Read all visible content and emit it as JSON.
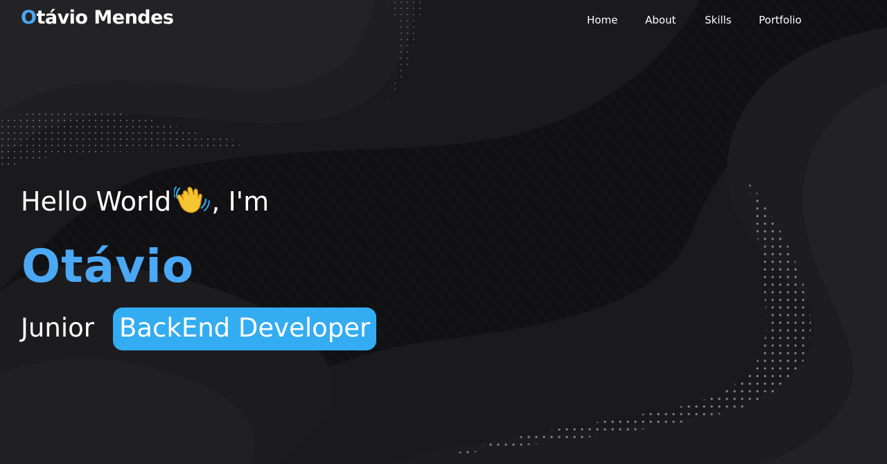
{
  "header": {
    "logo_initial": "O",
    "logo_rest": "távio Mendes"
  },
  "nav": {
    "home": "Home",
    "about": "About",
    "skills": "Skills",
    "portfolio": "Portfolio"
  },
  "hero": {
    "greeting_before": "Hello World",
    "greeting_after": ", I'm",
    "wave_icon": "waving-hand-emoji",
    "name": "Otávio",
    "role_prefix": "Junior",
    "role_highlight": "BackEnd Developer"
  },
  "colors": {
    "accent": "#4aa8f5",
    "badge": "#33acf2",
    "background": "#141416"
  }
}
